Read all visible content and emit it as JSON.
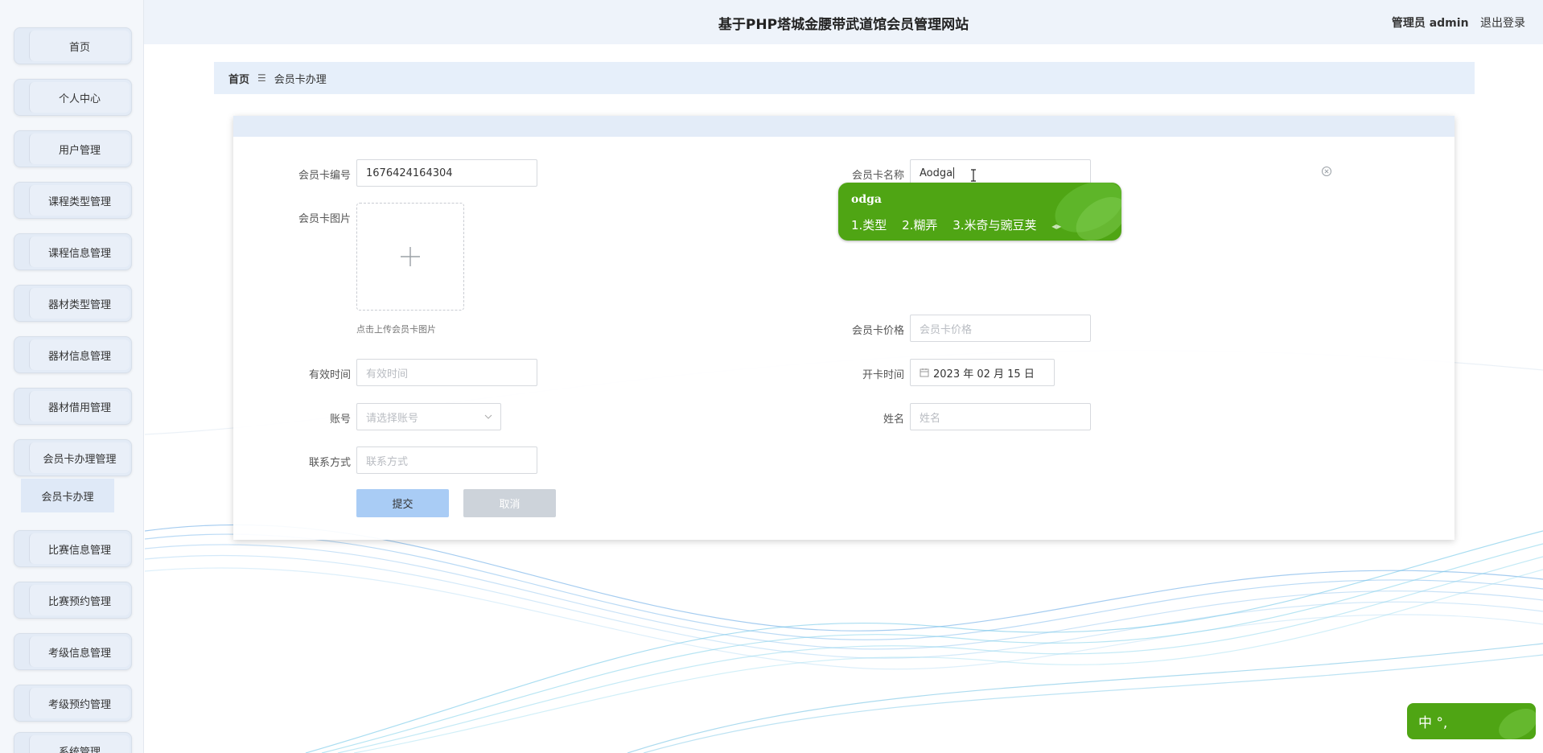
{
  "app": {
    "title": "基于PHP塔城金腰带武道馆会员管理网站"
  },
  "header": {
    "role_label": "管理员 admin",
    "logout_label": "退出登录"
  },
  "sidebar": {
    "items": [
      {
        "label": "首页"
      },
      {
        "label": "个人中心"
      },
      {
        "label": "用户管理"
      },
      {
        "label": "课程类型管理"
      },
      {
        "label": "课程信息管理"
      },
      {
        "label": "器材类型管理"
      },
      {
        "label": "器材信息管理"
      },
      {
        "label": "器材借用管理"
      },
      {
        "label": "会员卡办理管理"
      },
      {
        "label": "比赛信息管理"
      },
      {
        "label": "比赛预约管理"
      },
      {
        "label": "考级信息管理"
      },
      {
        "label": "考级预约管理"
      },
      {
        "label": "系统管理"
      }
    ],
    "sub_item": {
      "label": "会员卡办理"
    }
  },
  "breadcrumb": {
    "home": "首页",
    "current": "会员卡办理"
  },
  "form": {
    "card_no": {
      "label": "会员卡编号",
      "value": "1676424164304"
    },
    "card_name": {
      "label": "会员卡名称",
      "value": "Aodga"
    },
    "card_image": {
      "label": "会员卡图片",
      "hint": "点击上传会员卡图片"
    },
    "card_price": {
      "label": "会员卡价格",
      "placeholder": "会员卡价格"
    },
    "valid_time": {
      "label": "有效时间",
      "placeholder": "有效时间"
    },
    "open_time": {
      "label": "开卡时间",
      "value": "2023 年 02 月 15 日"
    },
    "account": {
      "label": "账号",
      "placeholder": "请选择账号"
    },
    "name": {
      "label": "姓名",
      "placeholder": "姓名"
    },
    "contact": {
      "label": "联系方式",
      "placeholder": "联系方式"
    },
    "submit_label": "提交",
    "cancel_label": "取消"
  },
  "ime": {
    "typed": "odga",
    "candidates": [
      "1.类型",
      "2.糊弄",
      "3.米奇与豌豆荚"
    ],
    "status": "中 °,"
  },
  "colors": {
    "ime_green": "#4fa514",
    "submit_blue": "#a9ccf5",
    "panel_header": "#e3ecf8"
  }
}
